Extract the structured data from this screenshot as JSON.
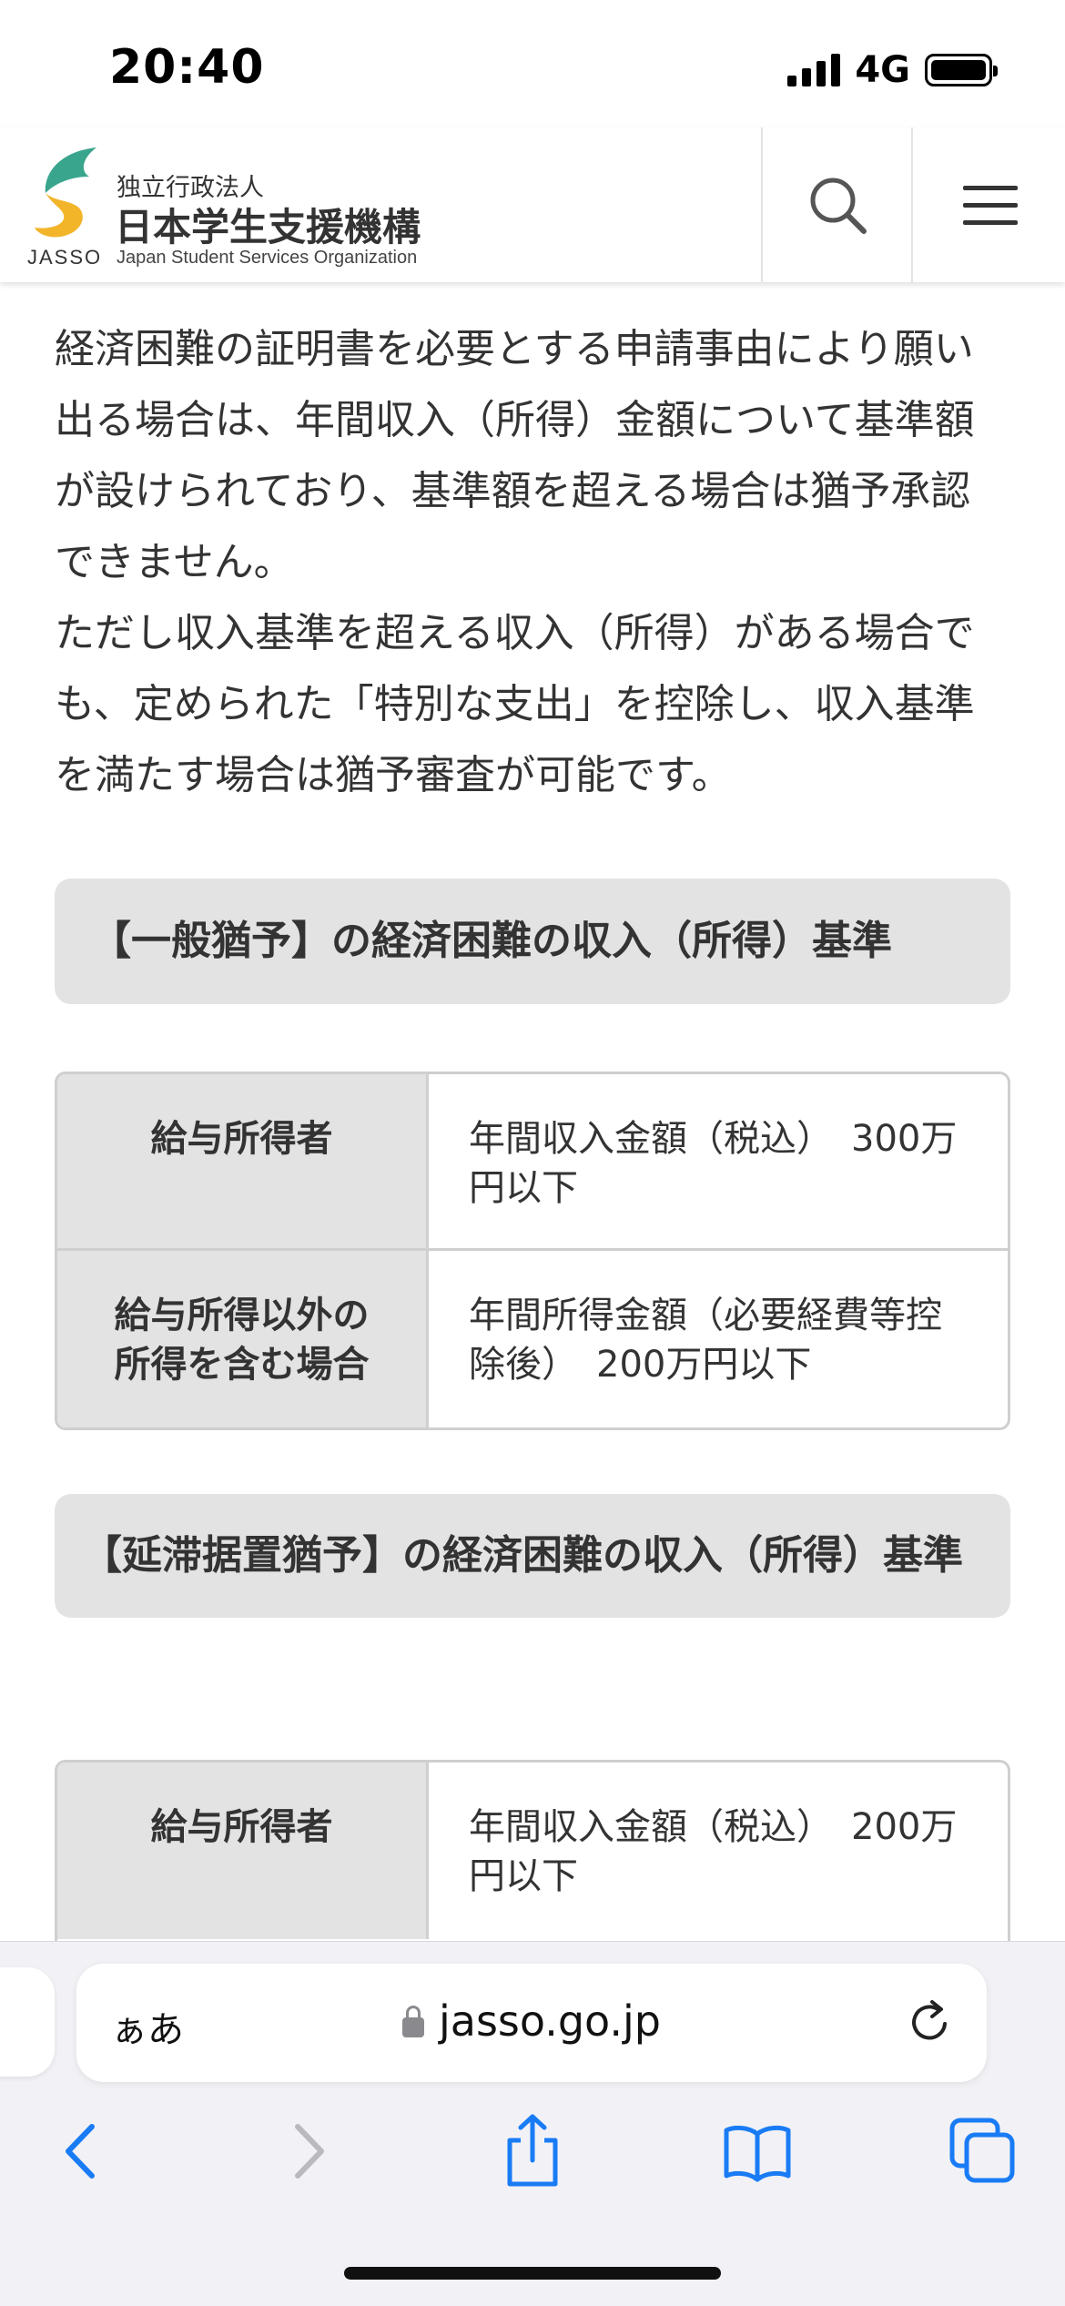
{
  "status_bar": {
    "time": "20:40",
    "network": "4G"
  },
  "header": {
    "logo_caption": "JASSO",
    "org_small": "独立行政法人",
    "org_name": "日本学生支援機構",
    "org_english": "Japan Student Services Organization",
    "search_icon": "search-icon",
    "menu_icon": "hamburger-menu-icon"
  },
  "content": {
    "intro_paragraphs": [
      "経済困難の証明書を必要とする申請事由により願い出る場合は、年間収入（所得）金額について基準額が設けられており、基準額を超える場合は猶予承認できません。",
      "ただし収入基準を超える収入（所得）がある場合でも、定められた「特別な支出」を控除し、収入基準を満たす場合は猶予審査が可能です。"
    ],
    "section1": {
      "title": "【一般猶予】の経済困難の収入（所得）基準",
      "rows": [
        {
          "label": "給与所得者",
          "value": "年間収入金額（税込）　300万円以下"
        },
        {
          "label": "給与所得以外の所得を含む場合",
          "value": "年間所得金額（必要経費等控除後）　200万円以下"
        }
      ]
    },
    "section2": {
      "title": "【延滞据置猶予】の経済困難の収入（所得）基準",
      "rows": [
        {
          "label": "給与所得者",
          "value": "年間収入金額（税込）　200万円以下"
        }
      ]
    }
  },
  "browser": {
    "aa_label": "ぁあ",
    "url": "jasso.go.jp",
    "icons": [
      "back-icon",
      "forward-icon",
      "share-icon",
      "bookmarks-icon",
      "tabs-icon",
      "reload-icon",
      "lock-icon"
    ]
  },
  "colors": {
    "logo_green": "#3aa58d",
    "logo_yellow": "#f2b52a",
    "section_bg": "#e3e3e3",
    "ios_blue": "#1a7cf5",
    "disabled_gray": "#b9b9be"
  }
}
